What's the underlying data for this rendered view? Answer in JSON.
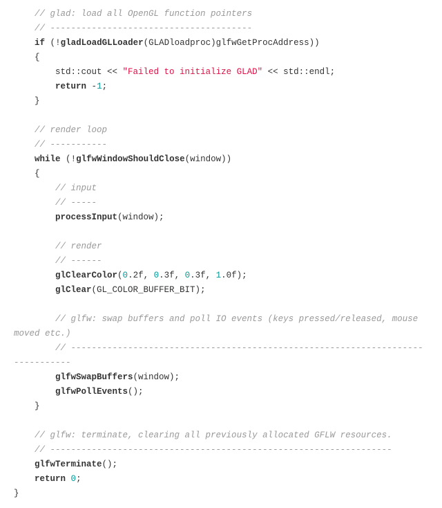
{
  "code": {
    "c1": "// glad: load all OpenGL function pointers",
    "c2": "// ---------------------------------------",
    "if": "if",
    "neg": "!",
    "gladLoad": "gladLoadGLLoader",
    "lp": "(",
    "rp": ")",
    "cast": "(GLADloadproc)",
    "getproc": "glfwGetProcAddress",
    "ob": "{",
    "cb": "}",
    "cout": "std::cout << ",
    "failstr": "\"Failed to initialize GLAD\"",
    "endl": " << std::endl;",
    "ret": "return",
    "neg1": "-",
    "one": "1",
    "semi": ";",
    "c3": "// render loop",
    "c4": "// -----------",
    "while": "while",
    "shouldClose": "glfwWindowShouldClose",
    "window": "(window)",
    "c5": "// input",
    "c6": "// -----",
    "processInput": "processInput",
    "windowSemi": "(window);",
    "c7": "// render",
    "c8": "// ------",
    "glClearColor": "glClearColor",
    "glClearArgs_p1": "(",
    "n02": "0",
    "d1": ".2f, ",
    "n03a": "0",
    "d2": ".3f, ",
    "n03b": "0",
    "d3": ".3f, ",
    "n1": "1",
    "d4": ".0f);",
    "glClear": "glClear",
    "glClearArgs": "(GL_COLOR_BUFFER_BIT);",
    "c9": "// glfw: swap buffers and poll IO events (keys pressed/released, mouse moved etc.)",
    "c10": "// -------------------------------------------------------------------------------",
    "swapBuffers": "glfwSwapBuffers",
    "pollEvents": "glfwPollEvents",
    "emptyArgsSemi": "();",
    "c11": "// glfw: terminate, clearing all previously allocated GFLW resources.",
    "c12": "// ------------------------------------------------------------------",
    "terminate": "glfwTerminate",
    "zero": "0"
  }
}
